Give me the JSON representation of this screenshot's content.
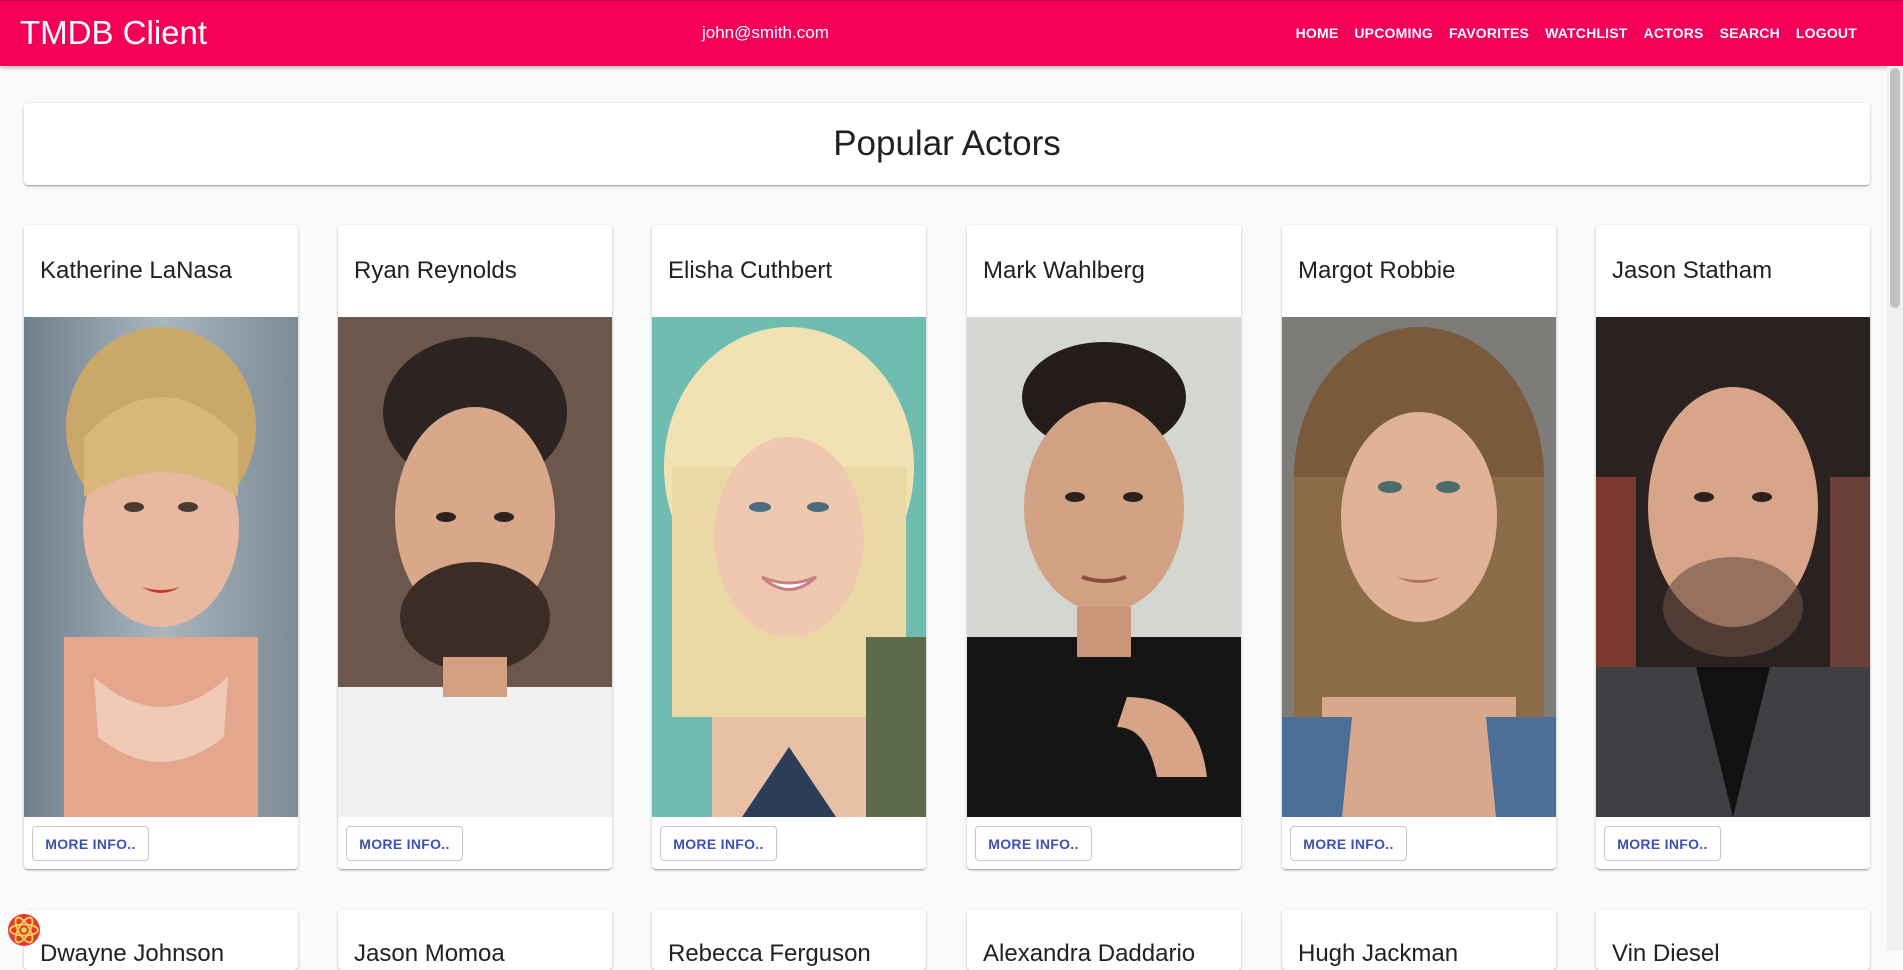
{
  "appbar": {
    "brand": "TMDB Client",
    "email": "john@smith.com",
    "nav": [
      "HOME",
      "UPCOMING",
      "FAVORITES",
      "WATCHLIST",
      "ACTORS",
      "SEARCH",
      "LOGOUT"
    ]
  },
  "page": {
    "title": "Popular Actors"
  },
  "actors": [
    {
      "name": "Katherine LaNasa",
      "button": "MORE INFO.."
    },
    {
      "name": "Ryan Reynolds",
      "button": "MORE INFO.."
    },
    {
      "name": "Elisha Cuthbert",
      "button": "MORE INFO.."
    },
    {
      "name": "Mark Wahlberg",
      "button": "MORE INFO.."
    },
    {
      "name": "Margot Robbie",
      "button": "MORE INFO.."
    },
    {
      "name": "Jason Statham",
      "button": "MORE INFO.."
    }
  ],
  "actors_row2": [
    {
      "name": "Dwayne Johnson"
    },
    {
      "name": "Jason Momoa"
    },
    {
      "name": "Rebecca Ferguson"
    },
    {
      "name": "Alexandra Daddario"
    },
    {
      "name": "Hugh Jackman"
    },
    {
      "name": "Vin Diesel"
    }
  ],
  "colors": {
    "primary": "#f50057",
    "button_text": "#3f51b5"
  }
}
